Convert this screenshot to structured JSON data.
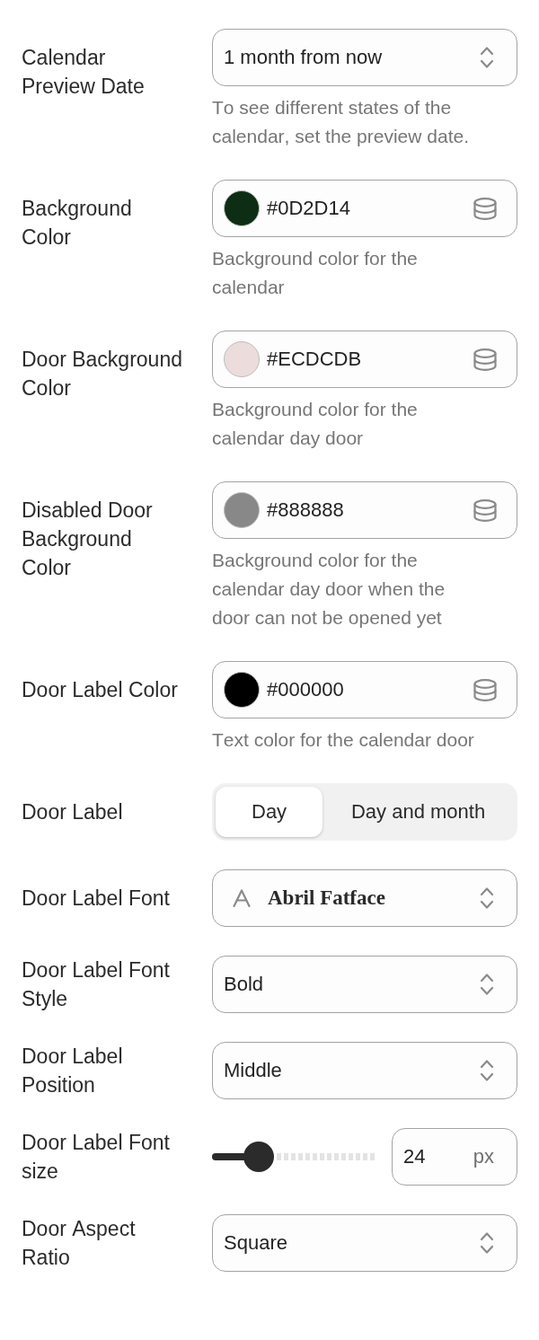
{
  "fields": [
    {
      "kind": "select",
      "label": "Calendar Preview Date",
      "value": "1 month from now",
      "help": "To see different states of the calendar, set the preview date."
    },
    {
      "kind": "color",
      "label": "Background Color",
      "value": "#0D2D14",
      "color": "#0d2d14",
      "help": "Background color for the calendar"
    },
    {
      "kind": "color",
      "label": "Door Background Color",
      "value": "#ECDCDB",
      "color": "#ecdcdb",
      "help": "Background color for the calendar day door"
    },
    {
      "kind": "color",
      "label": "Disabled Door Background Color",
      "value": "#888888",
      "color": "#888888",
      "help": "Background color for the calendar day door when the door can not be opened yet"
    },
    {
      "kind": "color",
      "label": "Door Label Color",
      "value": "#000000",
      "color": "#000000",
      "help": "Text color for the calendar door"
    },
    {
      "kind": "segmented",
      "label": "Door Label",
      "options": [
        {
          "label": "Day",
          "selected": true
        },
        {
          "label": "Day and month",
          "selected": false
        }
      ]
    },
    {
      "kind": "font",
      "label": "Door Label Font",
      "value": "Abril Fatface"
    },
    {
      "kind": "select",
      "label": "Door Label Font Style",
      "value": "Bold"
    },
    {
      "kind": "select",
      "label": "Door Label Position",
      "value": "Middle"
    },
    {
      "kind": "slider",
      "label": "Door Label Font size",
      "level": 0.28,
      "value": "24",
      "unit": "px"
    },
    {
      "kind": "select",
      "label": "Door Aspect Ratio",
      "value": "Square"
    }
  ]
}
